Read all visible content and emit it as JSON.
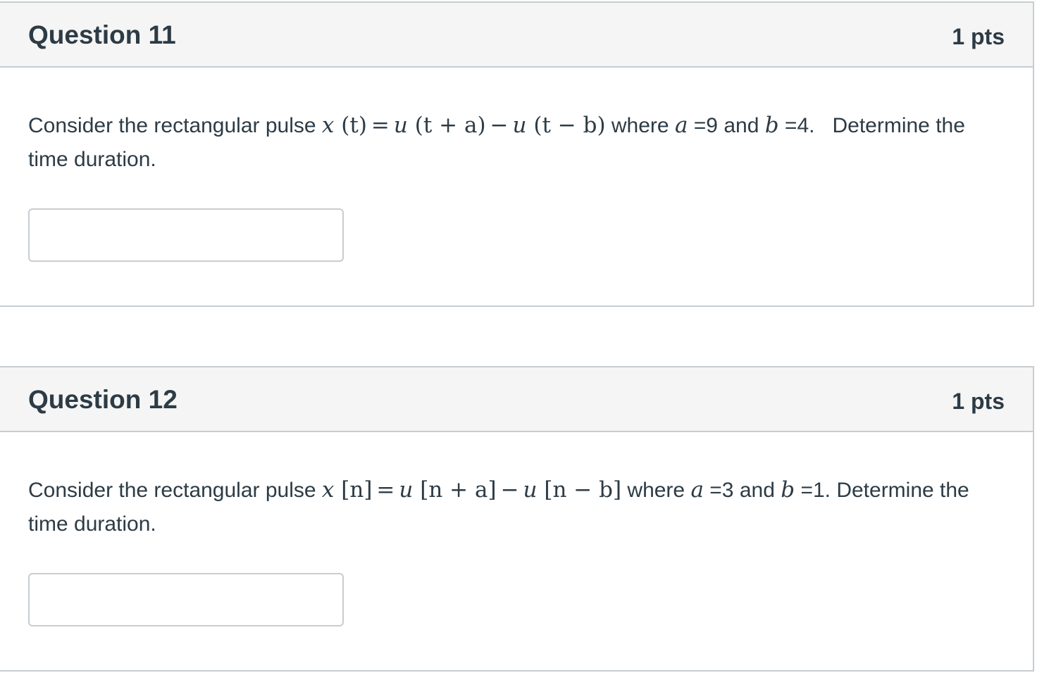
{
  "questions": [
    {
      "title": "Question 11",
      "points": "1 pts",
      "text_before": "Consider the rectangular pulse ",
      "equation": {
        "lhs_fn": "x",
        "lhs_arg": "(t)",
        "eq": "=",
        "term1_fn": "u",
        "term1_arg": "(t + a)",
        "minus": "−",
        "term2_fn": "u",
        "term2_arg": "(t − b)"
      },
      "text_where": " where ",
      "var_a": "a",
      "a_value": "=9",
      "text_and": " and ",
      "var_b": "b",
      "b_value": "=4.",
      "text_after": "   Determine the time duration.",
      "answer_value": ""
    },
    {
      "title": "Question 12",
      "points": "1 pts",
      "text_before": "Consider the rectangular pulse ",
      "equation": {
        "lhs_fn": "x",
        "lhs_arg": "[n]",
        "eq": "=",
        "term1_fn": "u",
        "term1_arg": "[n + a]",
        "minus": "−",
        "term2_fn": "u",
        "term2_arg": "[n − b]"
      },
      "text_where": " where ",
      "var_a": "a",
      "a_value": "=3",
      "text_and": " and ",
      "var_b": "b",
      "b_value": "=1.",
      "text_after": " Determine the time duration.",
      "answer_value": ""
    }
  ]
}
